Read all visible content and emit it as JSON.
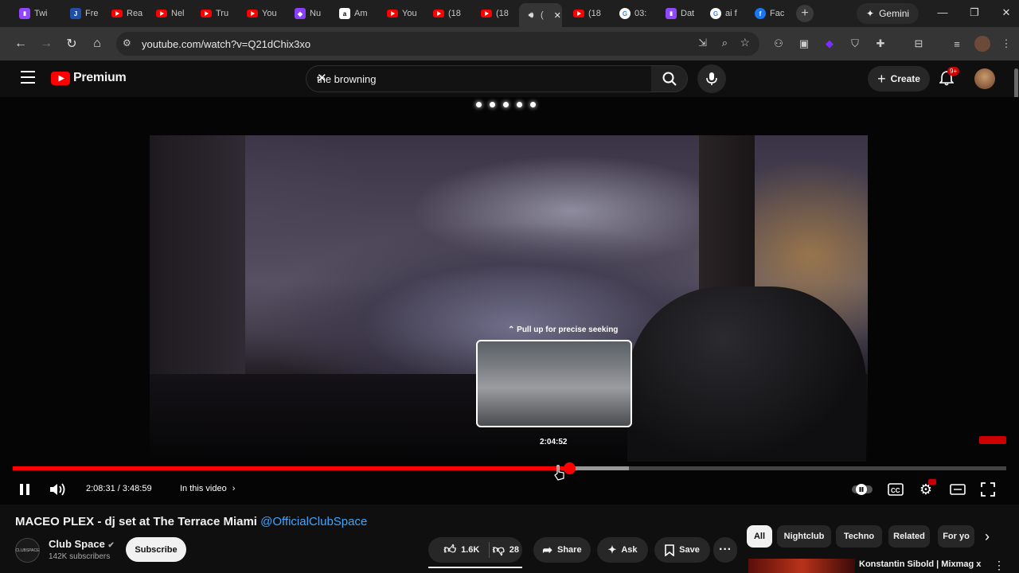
{
  "browser": {
    "tabs": [
      {
        "label": "Twi",
        "favicon": "twitch-icon",
        "color": "#9146ff"
      },
      {
        "label": "Fre",
        "favicon": "j-icon",
        "color": "#1f4fa8"
      },
      {
        "label": "Rea",
        "favicon": "youtube-icon",
        "color": "#ff0000"
      },
      {
        "label": "Nel",
        "favicon": "youtube-icon",
        "color": "#ff0000"
      },
      {
        "label": "Tru",
        "favicon": "youtube-icon",
        "color": "#ff0000"
      },
      {
        "label": "You",
        "favicon": "youtube-icon",
        "color": "#ff0000"
      },
      {
        "label": "Nu",
        "favicon": "nu-icon",
        "color": "#8a3ffc"
      },
      {
        "label": "Am",
        "favicon": "amazon-icon",
        "color": "#222222"
      },
      {
        "label": "You",
        "favicon": "youtube-icon",
        "color": "#ff0000"
      },
      {
        "label": "(18",
        "favicon": "youtube-icon",
        "color": "#ff0000"
      },
      {
        "label": "(18",
        "favicon": "youtube-icon",
        "color": "#ff0000"
      },
      {
        "label": "(",
        "favicon": "speaker-icon",
        "color": "#353535"
      },
      {
        "label": "(18",
        "favicon": "youtube-icon",
        "color": "#ff0000"
      },
      {
        "label": "03:",
        "favicon": "google-icon",
        "color": "#ffffff"
      },
      {
        "label": "Dat",
        "favicon": "twitch-icon",
        "color": "#9146ff"
      },
      {
        "label": "ai f",
        "favicon": "google-icon",
        "color": "#ffffff"
      },
      {
        "label": "Fac",
        "favicon": "facebook-icon",
        "color": "#1877f2"
      }
    ],
    "gemini_label": "Gemini",
    "url": "youtube.com/watch?v=Q21dChix3xo"
  },
  "youtube": {
    "logo_text": "Premium",
    "search_value": "the browning",
    "create_label": "Create",
    "notification_count": "9+",
    "accent": "#ff0000"
  },
  "player": {
    "seek_hint": "⌃ Pull up for precise seeking",
    "preview_time": "2:04:52",
    "current_time": "2:08:31",
    "duration": "3:48:59",
    "time_display": "2:08:31 / 3:48:59",
    "chapters_label": "In this video",
    "played_fraction": 0.5604,
    "buffered_fraction": 0.62
  },
  "video": {
    "title": "MACEO PLEX - dj set at The Terrace Miami",
    "title_handle": "@OfficialClubSpace",
    "channel_name": "Club Space",
    "avatar_text": "CLUBSPACE",
    "subscribers": "142K subscribers",
    "subscribe_label": "Subscribe",
    "likes": "1.6K",
    "dislikes": "28",
    "share_label": "Share",
    "ask_label": "Ask",
    "save_label": "Save"
  },
  "chips": [
    "All",
    "Nightclub",
    "Techno",
    "Related",
    "For yo"
  ],
  "next_video_title": "Konstantin Sibold | Mixmag x"
}
